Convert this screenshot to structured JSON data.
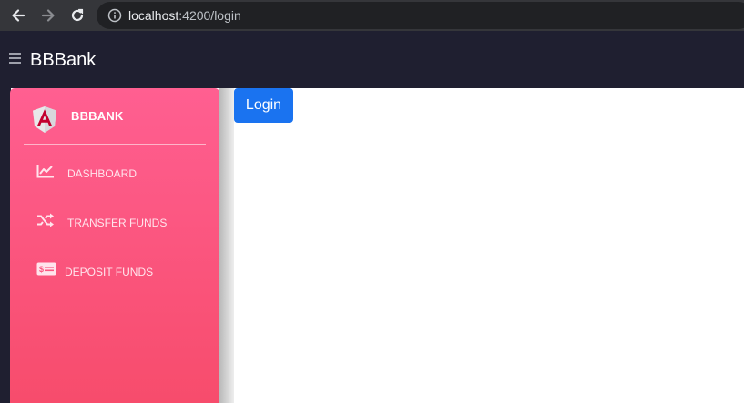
{
  "browser": {
    "url_host": "localhost",
    "url_path": ":4200/login"
  },
  "navbar": {
    "brand": "BBBank"
  },
  "sidebar": {
    "logo_text": "BBBANK",
    "items": [
      {
        "label": "DASHBOARD",
        "icon": "chart-line-icon"
      },
      {
        "label": "TRANSFER FUNDS",
        "icon": "shuffle-icon"
      },
      {
        "label": "DEPOSIT FUNDS",
        "icon": "money-bill-icon"
      }
    ]
  },
  "main": {
    "login_label": "Login"
  },
  "colors": {
    "navbar": "#1f1f30",
    "sidebar_top": "#ff5f91",
    "sidebar_bottom": "#f74c6c",
    "primary_button": "#1a73f0"
  }
}
